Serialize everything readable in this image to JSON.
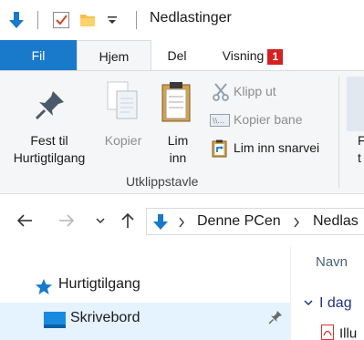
{
  "window": {
    "title": "Nedlastinger"
  },
  "quick_access_toolbar": {
    "icons": [
      "arrow-down-icon",
      "checkbox-properties-icon",
      "folder-icon",
      "customize-dropdown-icon"
    ]
  },
  "ribbon_tabs": [
    {
      "label": "Fil"
    },
    {
      "label": "Hjem"
    },
    {
      "label": "Del"
    },
    {
      "label": "Visning",
      "badge": "1"
    }
  ],
  "ribbon": {
    "pin_label_line1": "Fest til",
    "pin_label_line2": "Hurtigtilgang",
    "copy_label": "Kopier",
    "paste_label_line1": "Lim",
    "paste_label_line2": "inn",
    "cut_label": "Klipp ut",
    "copy_path_label": "Kopier bane",
    "paste_shortcut_label": "Lim inn snarvei",
    "group_label": "Utklippstavle",
    "next_group_partial_1": "F",
    "next_group_partial_2": "t"
  },
  "address_bar": {
    "crumbs": [
      "Denne PCen",
      "Nedlas"
    ]
  },
  "navigation_pane": {
    "quick_access": "Hurtigtilgang",
    "desktop": "Skrivebord"
  },
  "file_list": {
    "column_name": "Navn",
    "group_today": "I dag",
    "first_file_partial": "Illu"
  },
  "colors": {
    "accent": "#1979ca",
    "badge": "#d42020",
    "ribbon_bg": "#f5f6f7",
    "selection": "#e5f3ff"
  }
}
